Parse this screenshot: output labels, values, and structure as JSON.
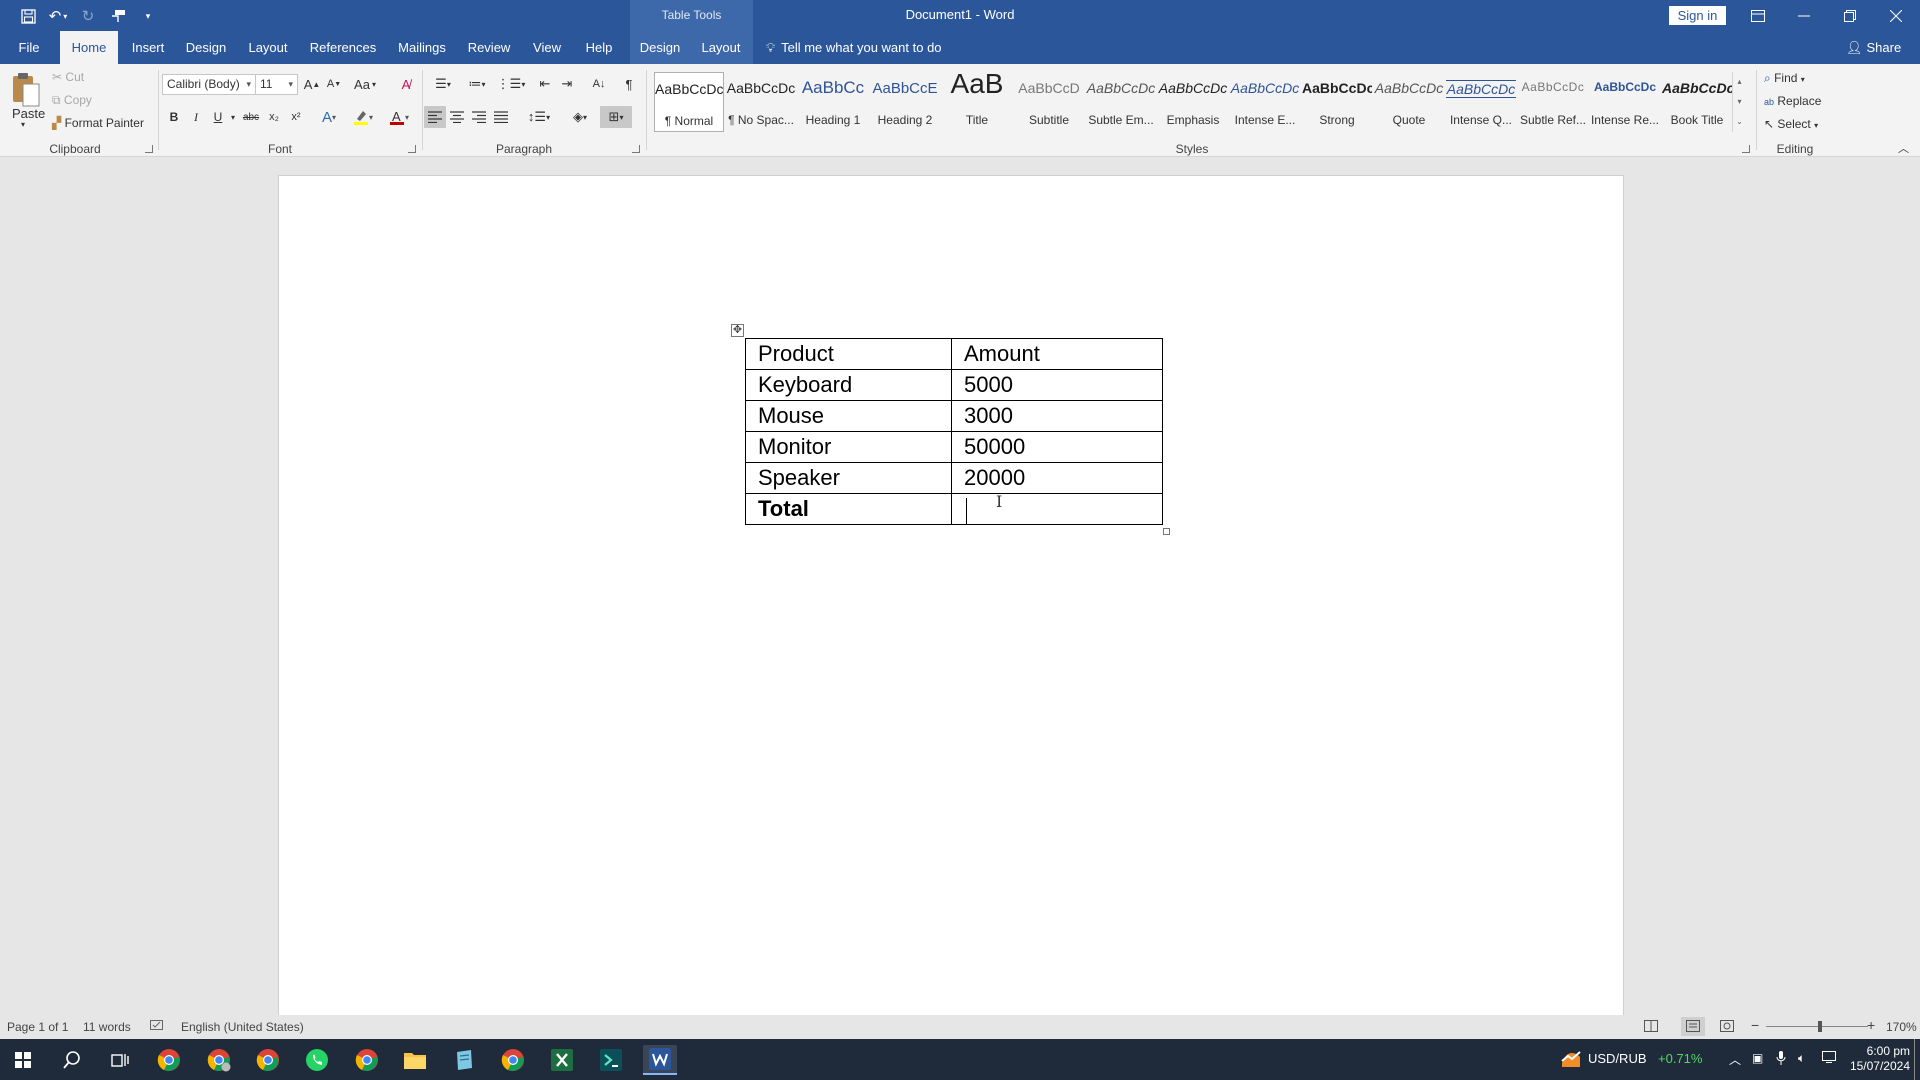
{
  "titlebar": {
    "contextual_label": "Table Tools",
    "title": "Document1 - Word",
    "signin": "Sign in"
  },
  "tabs": {
    "file": "File",
    "home": "Home",
    "insert": "Insert",
    "design": "Design",
    "layout": "Layout",
    "references": "References",
    "mailings": "Mailings",
    "review": "Review",
    "view": "View",
    "help": "Help",
    "table_design": "Design",
    "table_layout": "Layout",
    "tellme": "Tell me what you want to do",
    "share": "Share"
  },
  "clipboard": {
    "paste": "Paste",
    "cut": "Cut",
    "copy": "Copy",
    "format_painter": "Format Painter",
    "label": "Clipboard"
  },
  "font": {
    "name": "Calibri (Body)",
    "size": "11",
    "change_case": "Aa",
    "bold": "B",
    "italic": "I",
    "underline": "U",
    "strike": "abc",
    "subscript": "x₂",
    "superscript": "x²",
    "label": "Font",
    "font_color": "#c00000",
    "highlight_color": "#ffff00"
  },
  "paragraph": {
    "label": "Paragraph"
  },
  "styles": {
    "label": "Styles",
    "items": [
      {
        "preview": "AaBbCcDc",
        "name": "¶ Normal"
      },
      {
        "preview": "AaBbCcDc",
        "name": "¶ No Spac..."
      },
      {
        "preview": "AaBbCc",
        "name": "Heading 1"
      },
      {
        "preview": "AaBbCcE",
        "name": "Heading 2"
      },
      {
        "preview": "AaB",
        "name": "Title"
      },
      {
        "preview": "AaBbCcD",
        "name": "Subtitle"
      },
      {
        "preview": "AaBbCcDc",
        "name": "Subtle Em..."
      },
      {
        "preview": "AaBbCcDc",
        "name": "Emphasis"
      },
      {
        "preview": "AaBbCcDc",
        "name": "Intense E..."
      },
      {
        "preview": "AaBbCcDc",
        "name": "Strong"
      },
      {
        "preview": "AaBbCcDc",
        "name": "Quote"
      },
      {
        "preview": "AaBbCcDc",
        "name": "Intense Q..."
      },
      {
        "preview": "AaBbCcDc",
        "name": "Subtle Ref..."
      },
      {
        "preview": "AaBbCcDc",
        "name": "Intense Re..."
      },
      {
        "preview": "AaBbCcDc",
        "name": "Book Title"
      }
    ]
  },
  "editing": {
    "find": "Find",
    "replace": "Replace",
    "select": "Select",
    "label": "Editing"
  },
  "table": {
    "rows": [
      {
        "product": "Product",
        "amount": "Amount"
      },
      {
        "product": "Keyboard",
        "amount": "5000"
      },
      {
        "product": "Mouse",
        "amount": "3000"
      },
      {
        "product": "Monitor",
        "amount": "50000"
      },
      {
        "product": "Speaker",
        "amount": "20000"
      },
      {
        "product": "Total",
        "amount": ""
      }
    ]
  },
  "statusbar": {
    "page": "Page 1 of 1",
    "words": "11 words",
    "language": "English (United States)",
    "zoom": "170%"
  },
  "taskbar": {
    "ticker": "USD/RUB",
    "change": "+0.71%",
    "time": "6:00 pm",
    "date": "15/07/2024"
  }
}
